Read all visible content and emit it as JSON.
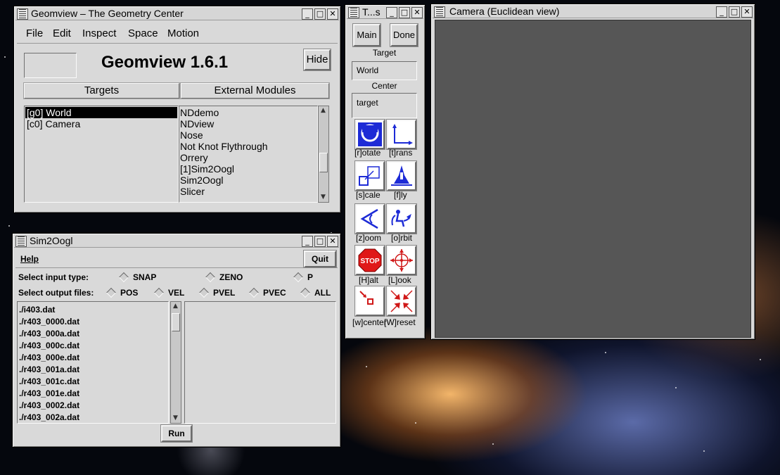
{
  "geomview": {
    "title": "Geomview – The Geometry Center",
    "menu": [
      "File",
      "Edit",
      "Inspect",
      "Space",
      "Motion"
    ],
    "app_name": "Geomview 1.6.1",
    "hide_label": "Hide",
    "targets_label": "Targets",
    "external_modules_label": "External Modules",
    "targets": [
      "[g0] World",
      "[c0] Camera"
    ],
    "modules": [
      "NDdemo",
      "NDview",
      "Nose",
      "Not Knot Flythrough",
      "Orrery",
      "[1]Sim2Oogl",
      "Sim2Oogl",
      "Slicer"
    ]
  },
  "tools": {
    "title": "T...s",
    "main_label": "Main",
    "done_label": "Done",
    "target_heading": "Target",
    "target_value": "World",
    "center_heading": "Center",
    "center_value": "target",
    "buttons": [
      {
        "label": "[r]otate",
        "icon": "rotate-icon"
      },
      {
        "label": "[t]rans",
        "icon": "translate-icon"
      },
      {
        "label": "[s]cale",
        "icon": "scale-icon"
      },
      {
        "label": "[f]ly",
        "icon": "fly-icon"
      },
      {
        "label": "[z]oom",
        "icon": "zoom-icon"
      },
      {
        "label": "[o]rbit",
        "icon": "orbit-icon"
      },
      {
        "label": "[H]alt",
        "icon": "stop-icon"
      },
      {
        "label": "[L]ook",
        "icon": "look-icon"
      },
      {
        "label": "[w]center",
        "icon": "center-icon"
      },
      {
        "label": "[W]reset",
        "icon": "reset-icon"
      }
    ],
    "stop_text": "STOP"
  },
  "camera": {
    "title": "Camera (Euclidean view)"
  },
  "sim2oogl": {
    "title": "Sim2Oogl",
    "help_label": "Help",
    "quit_label": "Quit",
    "input_label": "Select input type:",
    "input_options": [
      "SNAP",
      "ZENO",
      "P"
    ],
    "output_label": "Select output files:",
    "output_options": [
      "POS",
      "VEL",
      "PVEL",
      "PVEC",
      "ALL"
    ],
    "files": [
      "./i403.dat",
      "./r403_0000.dat",
      "./r403_000a.dat",
      "./r403_000c.dat",
      "./r403_000e.dat",
      "./r403_001a.dat",
      "./r403_001c.dat",
      "./r403_001e.dat",
      "./r403_0002.dat",
      "./r403_002a.dat"
    ],
    "run_label": "Run"
  }
}
